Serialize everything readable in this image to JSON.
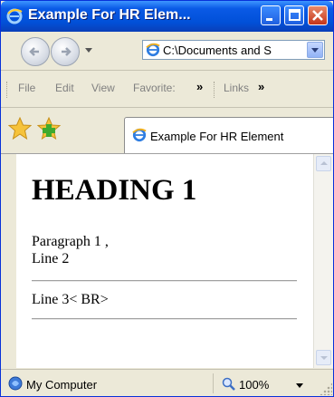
{
  "window": {
    "title": "Example For HR Elem...",
    "title_color": "#0150d8"
  },
  "toolbar": {
    "address": "C:\\Documents and S",
    "menu": [
      "File",
      "Edit",
      "View",
      "Favorite:"
    ],
    "chevron": "»",
    "links_label": "Links",
    "links_chevron": "»"
  },
  "tab": {
    "label": "Example For HR Element"
  },
  "content": {
    "heading": "HEADING 1",
    "para1": "Paragraph 1 ,",
    "para2": "Line 2",
    "para3": "Line 3< BR>"
  },
  "status": {
    "zone": "My Computer",
    "zoom": "100%"
  },
  "icons": [
    "ie-logo-icon",
    "minimize-icon",
    "maximize-icon",
    "close-icon",
    "back-arrow-icon",
    "forward-arrow-icon",
    "favorites-star-icon",
    "add-favorite-icon",
    "computer-icon",
    "zoom-icon"
  ]
}
